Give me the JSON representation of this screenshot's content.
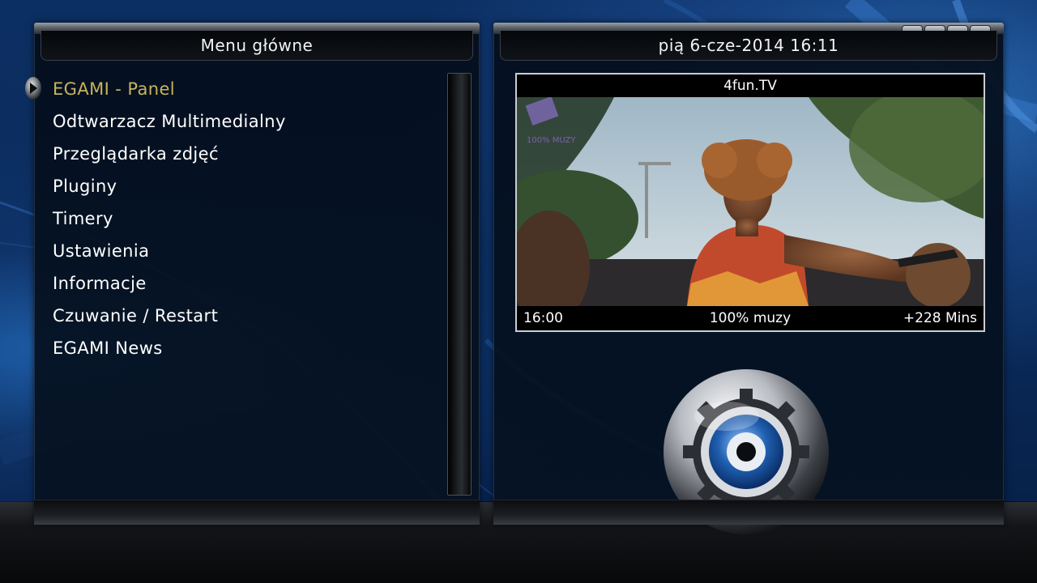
{
  "left_panel": {
    "title": "Menu główne",
    "menu_items": [
      {
        "label": "EGAMI - Panel",
        "selected": true
      },
      {
        "label": "Odtwarzacz Multimedialny",
        "selected": false
      },
      {
        "label": "Przeglądarka zdjęć",
        "selected": false
      },
      {
        "label": "Pluginy",
        "selected": false
      },
      {
        "label": "Timery",
        "selected": false
      },
      {
        "label": "Ustawienia",
        "selected": false
      },
      {
        "label": "Informacje",
        "selected": false
      },
      {
        "label": "Czuwanie / Restart",
        "selected": false
      },
      {
        "label": "EGAMI News",
        "selected": false
      }
    ]
  },
  "right_panel": {
    "datetime": "pią  6-cze-2014 16:11",
    "preview": {
      "channel": "4fun.TV",
      "start_time": "16:00",
      "program": "100% muzy",
      "remaining": "+228 Mins",
      "watermark_text": "100% MUZY"
    }
  },
  "colors": {
    "selected_item": "#c8b45a",
    "menu_text": "#ffffff",
    "accent_blue": "#1f5fb0"
  },
  "icons": {
    "selector": "arrow-right-icon",
    "logo": "gear-eye-logo-icon"
  }
}
